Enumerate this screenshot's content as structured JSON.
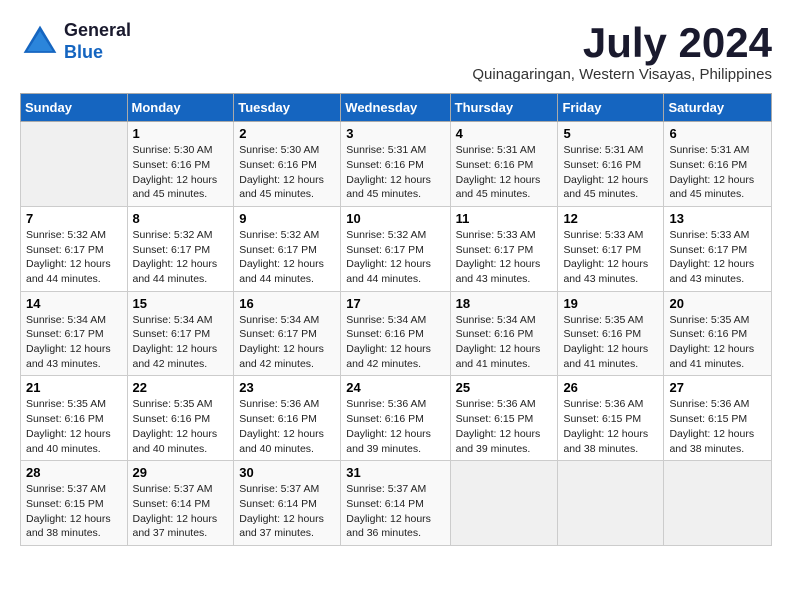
{
  "header": {
    "logo_line1": "General",
    "logo_line2": "Blue",
    "month_year": "July 2024",
    "location": "Quinagaringan, Western Visayas, Philippines"
  },
  "weekdays": [
    "Sunday",
    "Monday",
    "Tuesday",
    "Wednesday",
    "Thursday",
    "Friday",
    "Saturday"
  ],
  "weeks": [
    [
      {
        "day": "",
        "info": ""
      },
      {
        "day": "1",
        "info": "Sunrise: 5:30 AM\nSunset: 6:16 PM\nDaylight: 12 hours\nand 45 minutes."
      },
      {
        "day": "2",
        "info": "Sunrise: 5:30 AM\nSunset: 6:16 PM\nDaylight: 12 hours\nand 45 minutes."
      },
      {
        "day": "3",
        "info": "Sunrise: 5:31 AM\nSunset: 6:16 PM\nDaylight: 12 hours\nand 45 minutes."
      },
      {
        "day": "4",
        "info": "Sunrise: 5:31 AM\nSunset: 6:16 PM\nDaylight: 12 hours\nand 45 minutes."
      },
      {
        "day": "5",
        "info": "Sunrise: 5:31 AM\nSunset: 6:16 PM\nDaylight: 12 hours\nand 45 minutes."
      },
      {
        "day": "6",
        "info": "Sunrise: 5:31 AM\nSunset: 6:16 PM\nDaylight: 12 hours\nand 45 minutes."
      }
    ],
    [
      {
        "day": "7",
        "info": "Sunrise: 5:32 AM\nSunset: 6:17 PM\nDaylight: 12 hours\nand 44 minutes."
      },
      {
        "day": "8",
        "info": "Sunrise: 5:32 AM\nSunset: 6:17 PM\nDaylight: 12 hours\nand 44 minutes."
      },
      {
        "day": "9",
        "info": "Sunrise: 5:32 AM\nSunset: 6:17 PM\nDaylight: 12 hours\nand 44 minutes."
      },
      {
        "day": "10",
        "info": "Sunrise: 5:32 AM\nSunset: 6:17 PM\nDaylight: 12 hours\nand 44 minutes."
      },
      {
        "day": "11",
        "info": "Sunrise: 5:33 AM\nSunset: 6:17 PM\nDaylight: 12 hours\nand 43 minutes."
      },
      {
        "day": "12",
        "info": "Sunrise: 5:33 AM\nSunset: 6:17 PM\nDaylight: 12 hours\nand 43 minutes."
      },
      {
        "day": "13",
        "info": "Sunrise: 5:33 AM\nSunset: 6:17 PM\nDaylight: 12 hours\nand 43 minutes."
      }
    ],
    [
      {
        "day": "14",
        "info": "Sunrise: 5:34 AM\nSunset: 6:17 PM\nDaylight: 12 hours\nand 43 minutes."
      },
      {
        "day": "15",
        "info": "Sunrise: 5:34 AM\nSunset: 6:17 PM\nDaylight: 12 hours\nand 42 minutes."
      },
      {
        "day": "16",
        "info": "Sunrise: 5:34 AM\nSunset: 6:17 PM\nDaylight: 12 hours\nand 42 minutes."
      },
      {
        "day": "17",
        "info": "Sunrise: 5:34 AM\nSunset: 6:16 PM\nDaylight: 12 hours\nand 42 minutes."
      },
      {
        "day": "18",
        "info": "Sunrise: 5:34 AM\nSunset: 6:16 PM\nDaylight: 12 hours\nand 41 minutes."
      },
      {
        "day": "19",
        "info": "Sunrise: 5:35 AM\nSunset: 6:16 PM\nDaylight: 12 hours\nand 41 minutes."
      },
      {
        "day": "20",
        "info": "Sunrise: 5:35 AM\nSunset: 6:16 PM\nDaylight: 12 hours\nand 41 minutes."
      }
    ],
    [
      {
        "day": "21",
        "info": "Sunrise: 5:35 AM\nSunset: 6:16 PM\nDaylight: 12 hours\nand 40 minutes."
      },
      {
        "day": "22",
        "info": "Sunrise: 5:35 AM\nSunset: 6:16 PM\nDaylight: 12 hours\nand 40 minutes."
      },
      {
        "day": "23",
        "info": "Sunrise: 5:36 AM\nSunset: 6:16 PM\nDaylight: 12 hours\nand 40 minutes."
      },
      {
        "day": "24",
        "info": "Sunrise: 5:36 AM\nSunset: 6:16 PM\nDaylight: 12 hours\nand 39 minutes."
      },
      {
        "day": "25",
        "info": "Sunrise: 5:36 AM\nSunset: 6:15 PM\nDaylight: 12 hours\nand 39 minutes."
      },
      {
        "day": "26",
        "info": "Sunrise: 5:36 AM\nSunset: 6:15 PM\nDaylight: 12 hours\nand 38 minutes."
      },
      {
        "day": "27",
        "info": "Sunrise: 5:36 AM\nSunset: 6:15 PM\nDaylight: 12 hours\nand 38 minutes."
      }
    ],
    [
      {
        "day": "28",
        "info": "Sunrise: 5:37 AM\nSunset: 6:15 PM\nDaylight: 12 hours\nand 38 minutes."
      },
      {
        "day": "29",
        "info": "Sunrise: 5:37 AM\nSunset: 6:14 PM\nDaylight: 12 hours\nand 37 minutes."
      },
      {
        "day": "30",
        "info": "Sunrise: 5:37 AM\nSunset: 6:14 PM\nDaylight: 12 hours\nand 37 minutes."
      },
      {
        "day": "31",
        "info": "Sunrise: 5:37 AM\nSunset: 6:14 PM\nDaylight: 12 hours\nand 36 minutes."
      },
      {
        "day": "",
        "info": ""
      },
      {
        "day": "",
        "info": ""
      },
      {
        "day": "",
        "info": ""
      }
    ]
  ]
}
